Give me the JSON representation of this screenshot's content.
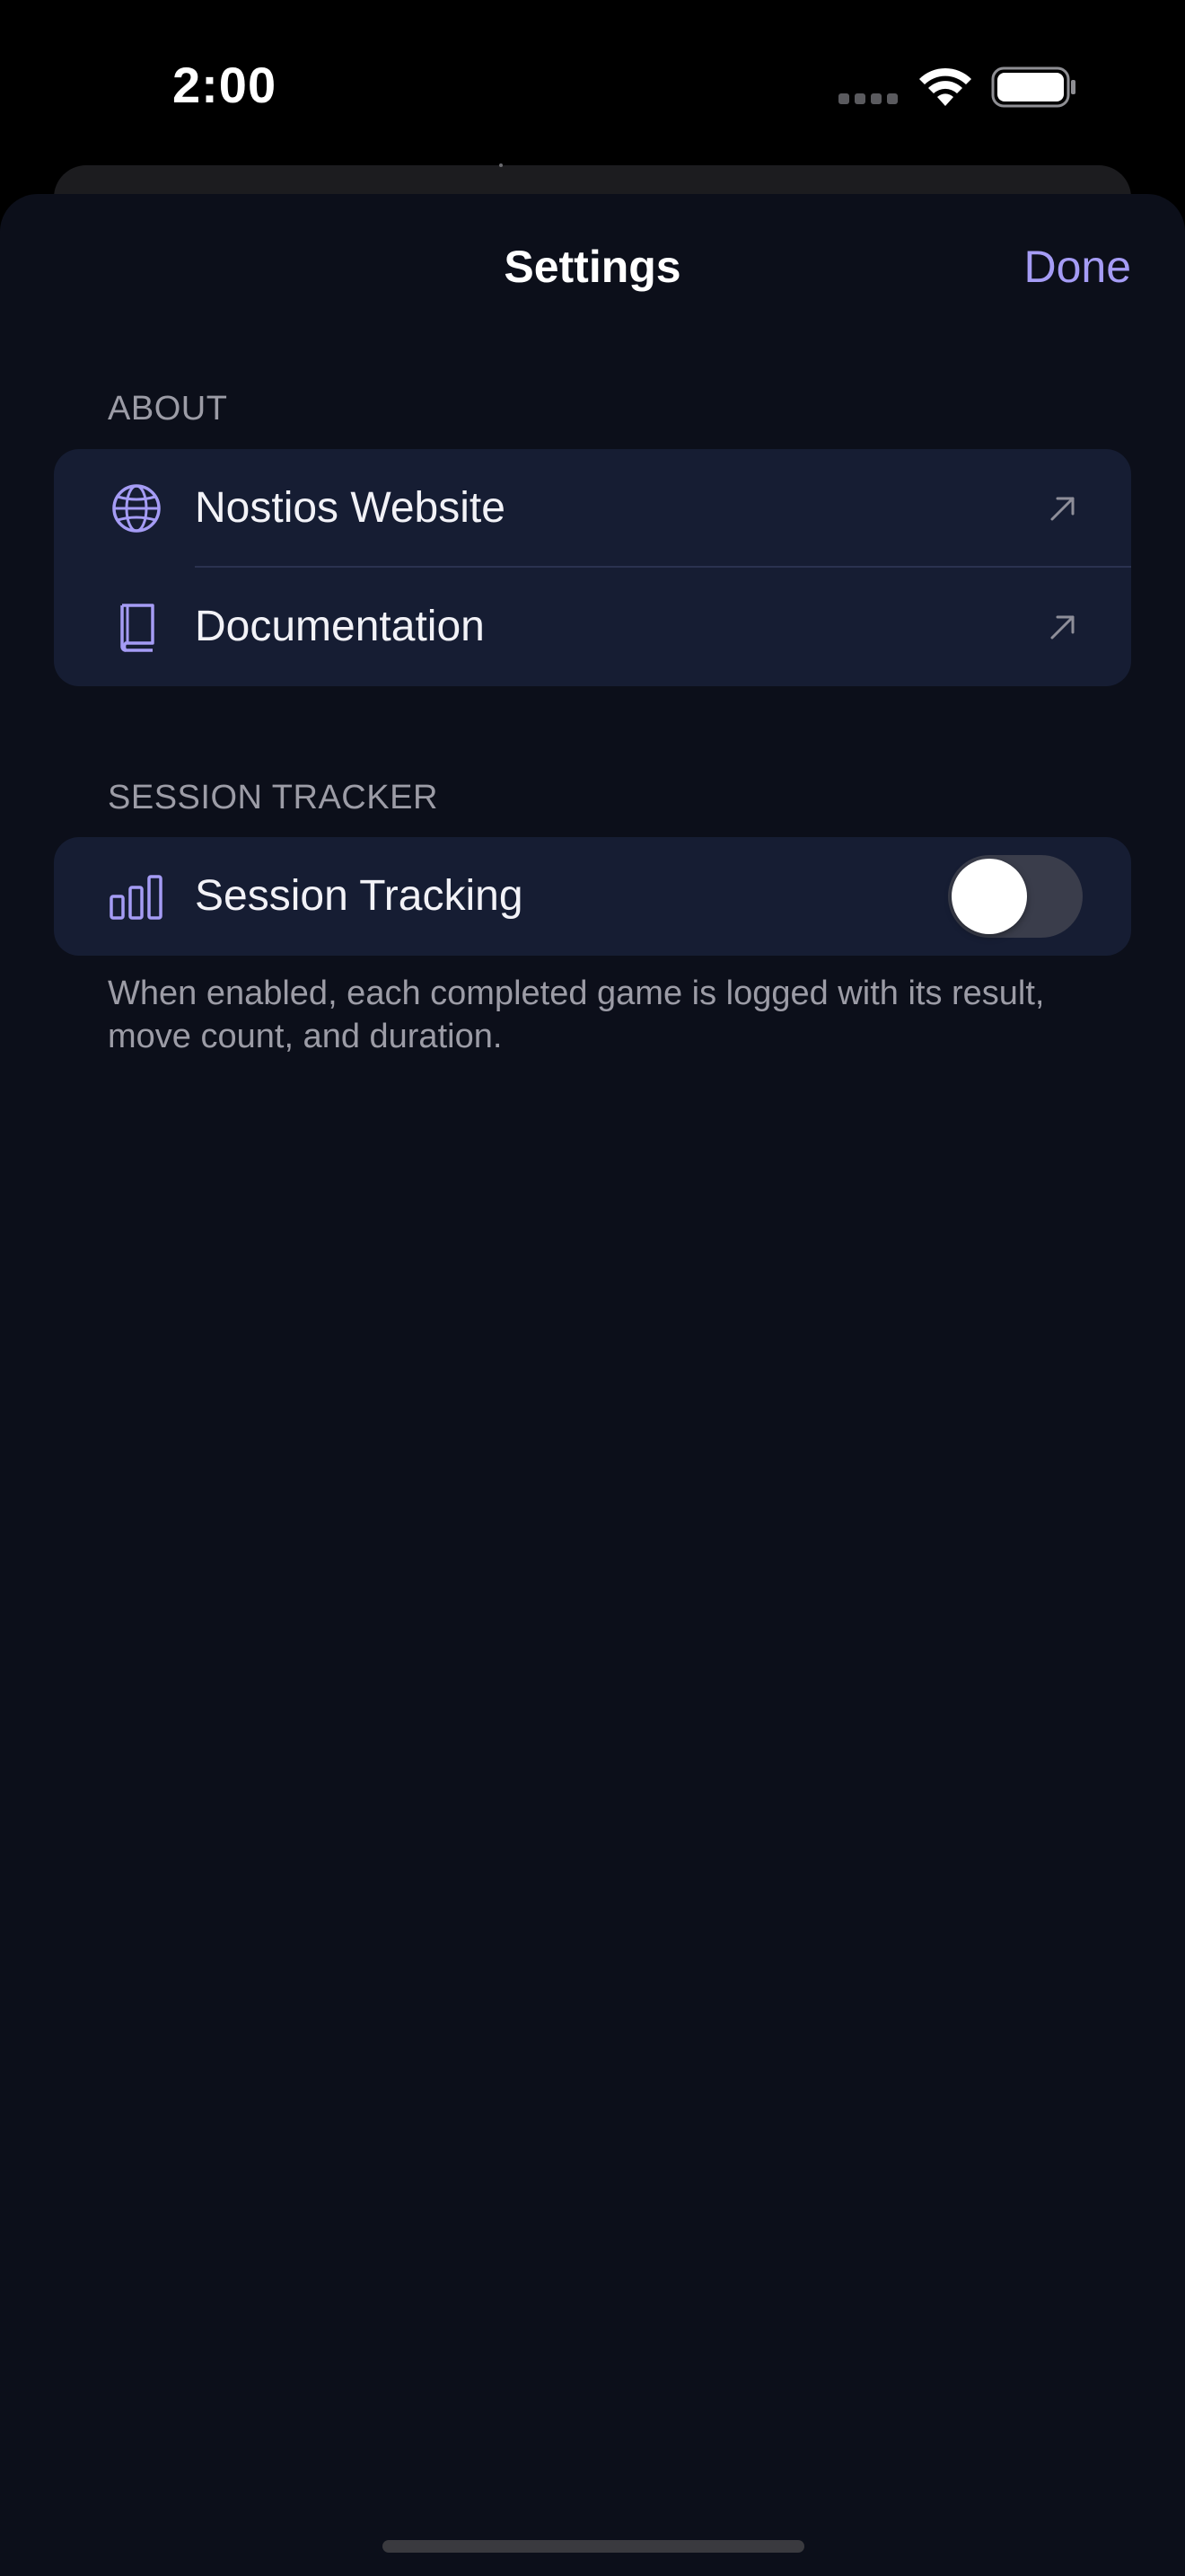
{
  "status_bar": {
    "time": "2:00",
    "signal_icon": "cellular-signal-icon",
    "wifi_icon": "wifi-icon",
    "battery_icon": "battery-icon"
  },
  "nav": {
    "title": "Settings",
    "done_label": "Done"
  },
  "sections": {
    "about": {
      "header": "ABOUT",
      "items": [
        {
          "label": "Nostios Website",
          "icon": "globe-icon",
          "accessory": "external-link-arrow-icon"
        },
        {
          "label": "Documentation",
          "icon": "book-icon",
          "accessory": "external-link-arrow-icon"
        }
      ]
    },
    "session_tracker": {
      "header": "SESSION TRACKER",
      "items": [
        {
          "label": "Session Tracking",
          "icon": "bar-chart-icon",
          "toggle_on": false
        }
      ],
      "footer": "When enabled, each completed game is logged with its result, move count, and duration."
    }
  },
  "colors": {
    "accent": "#a59cf5",
    "sheet_background": "#0c0f1a",
    "group_background": "#161d33",
    "toggle_off": "#3a3d4b"
  }
}
